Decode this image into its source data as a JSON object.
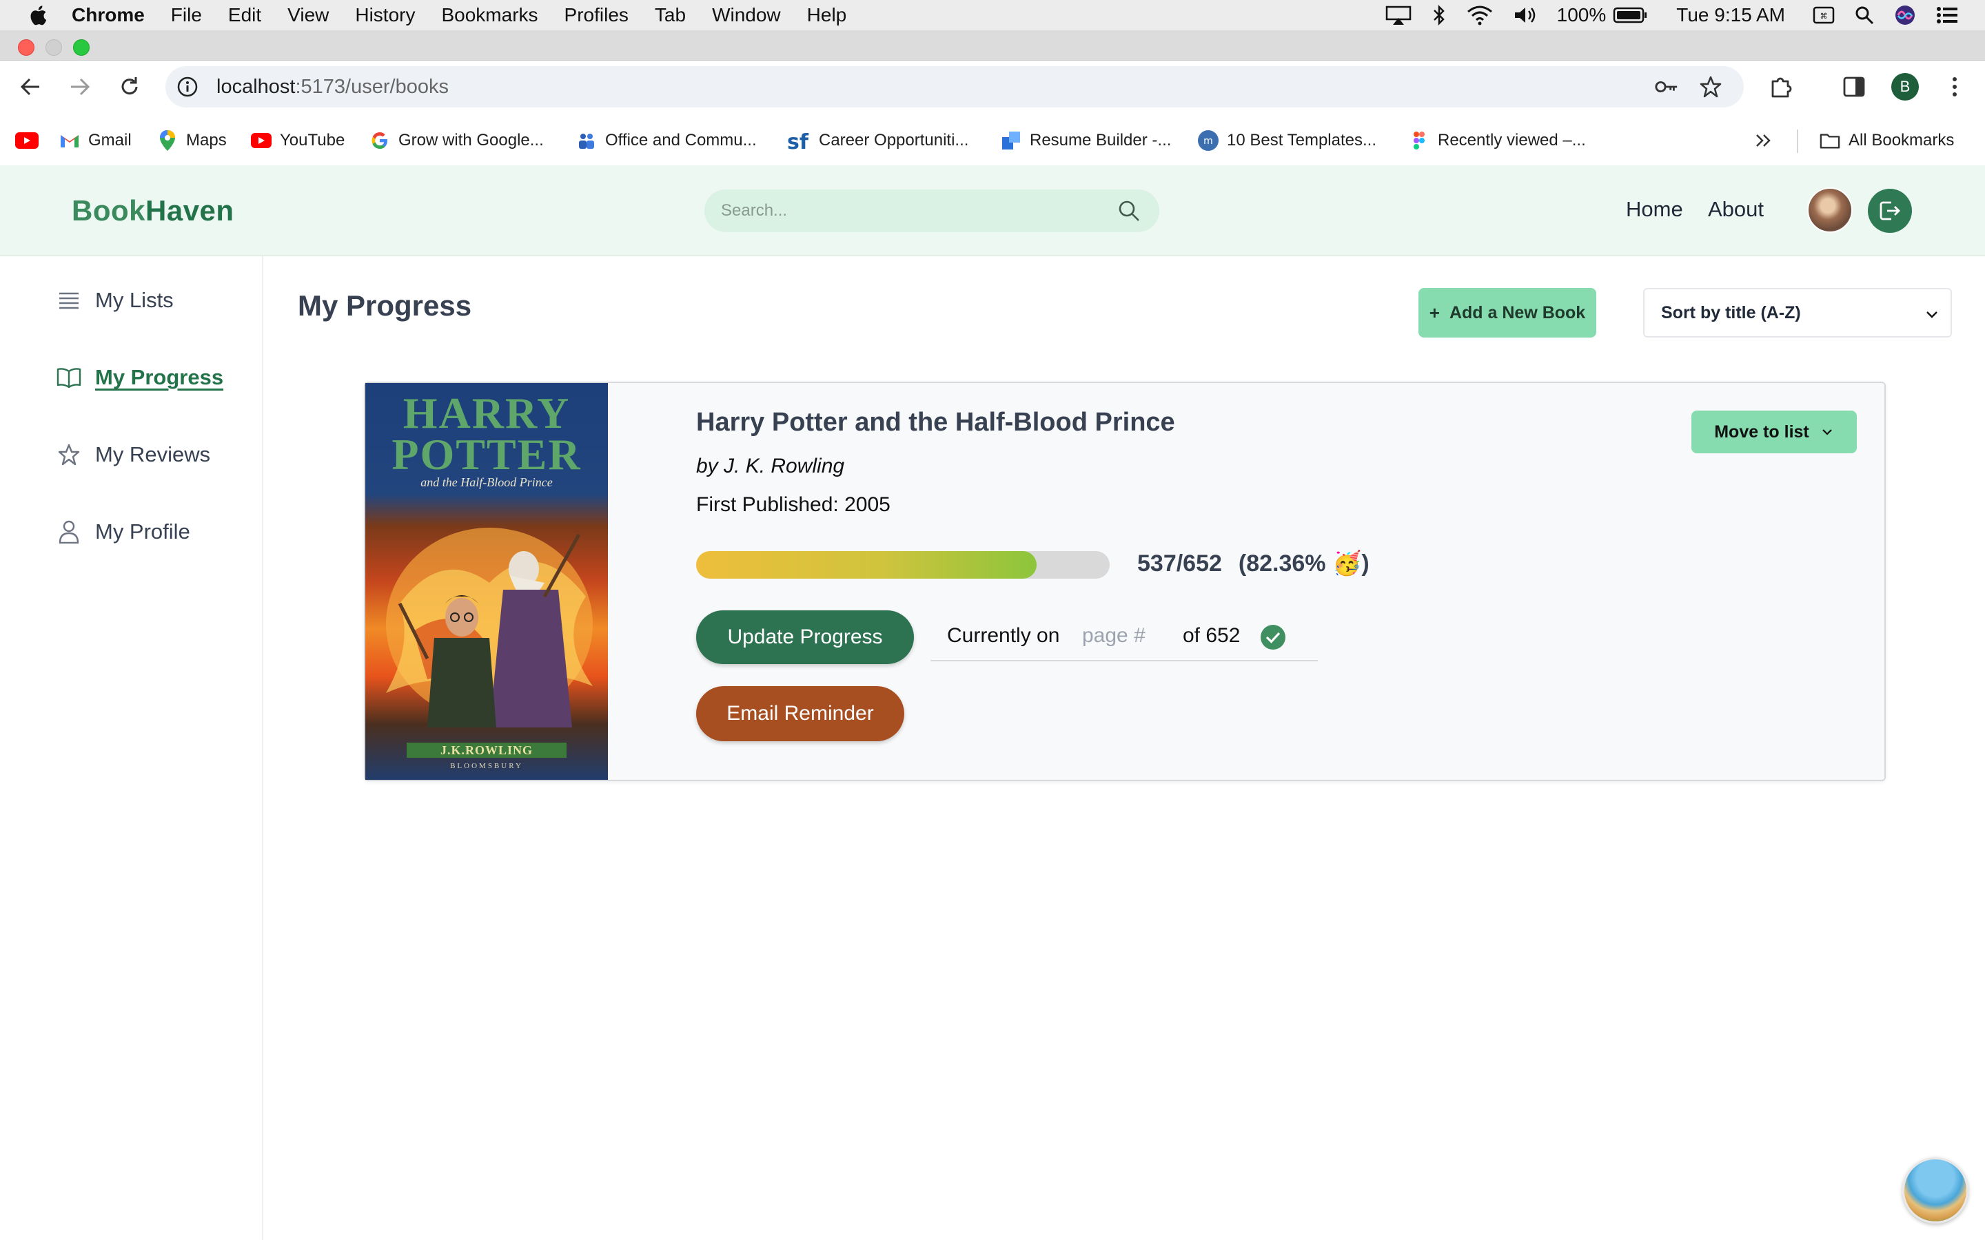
{
  "menubar": {
    "app_name": "Chrome",
    "menus": [
      "File",
      "Edit",
      "View",
      "History",
      "Bookmarks",
      "Profiles",
      "Tab",
      "Window",
      "Help"
    ],
    "battery": "100%",
    "clock": "Tue 9:15 AM"
  },
  "browser": {
    "url_host": "localhost",
    "url_rest": ":5173/user/books",
    "profile_initial": "B",
    "bookmarks": [
      {
        "label": "Gmail",
        "icon": "gmail-icon"
      },
      {
        "label": "Maps",
        "icon": "maps-icon"
      },
      {
        "label": "YouTube",
        "icon": "youtube-icon"
      },
      {
        "label": "Grow with Google...",
        "icon": "google-icon"
      },
      {
        "label": "Office and Commu...",
        "icon": "office-icon"
      },
      {
        "label": "Career Opportuniti...",
        "icon": "sf-icon"
      },
      {
        "label": "Resume Builder -...",
        "icon": "resume-icon"
      },
      {
        "label": "10 Best Templates...",
        "icon": "template-icon"
      },
      {
        "label": "Recently viewed –...",
        "icon": "figma-icon"
      }
    ],
    "all_bookmarks": "All Bookmarks"
  },
  "header": {
    "logo_part1": "Book",
    "logo_part2": "Haven",
    "search_placeholder": "Search...",
    "nav": {
      "home": "Home",
      "about": "About"
    }
  },
  "sidebar": {
    "items": [
      {
        "label": "My Lists",
        "icon": "list-icon",
        "active": false
      },
      {
        "label": "My Progress",
        "icon": "open-book-icon",
        "active": true
      },
      {
        "label": "My Reviews",
        "icon": "star-icon",
        "active": false
      },
      {
        "label": "My Profile",
        "icon": "user-icon",
        "active": false
      }
    ]
  },
  "main": {
    "title": "My Progress",
    "add_button": "Add a New Book",
    "add_plus": "+",
    "sort_selected": "Sort by title (A-Z)"
  },
  "book": {
    "cover_title_line1": "HARRY",
    "cover_title_line2": "POTTER",
    "cover_subtitle": "and the Half-Blood Prince",
    "cover_author": "J.K.ROWLING",
    "cover_publisher": "BLOOMSBURY",
    "title": "Harry Potter and the Half-Blood Prince",
    "author": "by J. K. Rowling",
    "published": "First Published: 2005",
    "pages_read": 537,
    "pages_total": 652,
    "progress_fraction": 0.8236,
    "progress_label": "537/652",
    "percent_label": "(82.36% 🥳)",
    "update_button": "Update Progress",
    "currently_on": "Currently on",
    "page_placeholder": "page #",
    "of_total": "of 652",
    "email_button": "Email Reminder",
    "move_button": "Move to list"
  },
  "colors": {
    "brand_green": "#2d7352",
    "accent_mint": "#86dcae",
    "header_bg": "#ecf8f1",
    "email_orange": "#a84f22"
  }
}
